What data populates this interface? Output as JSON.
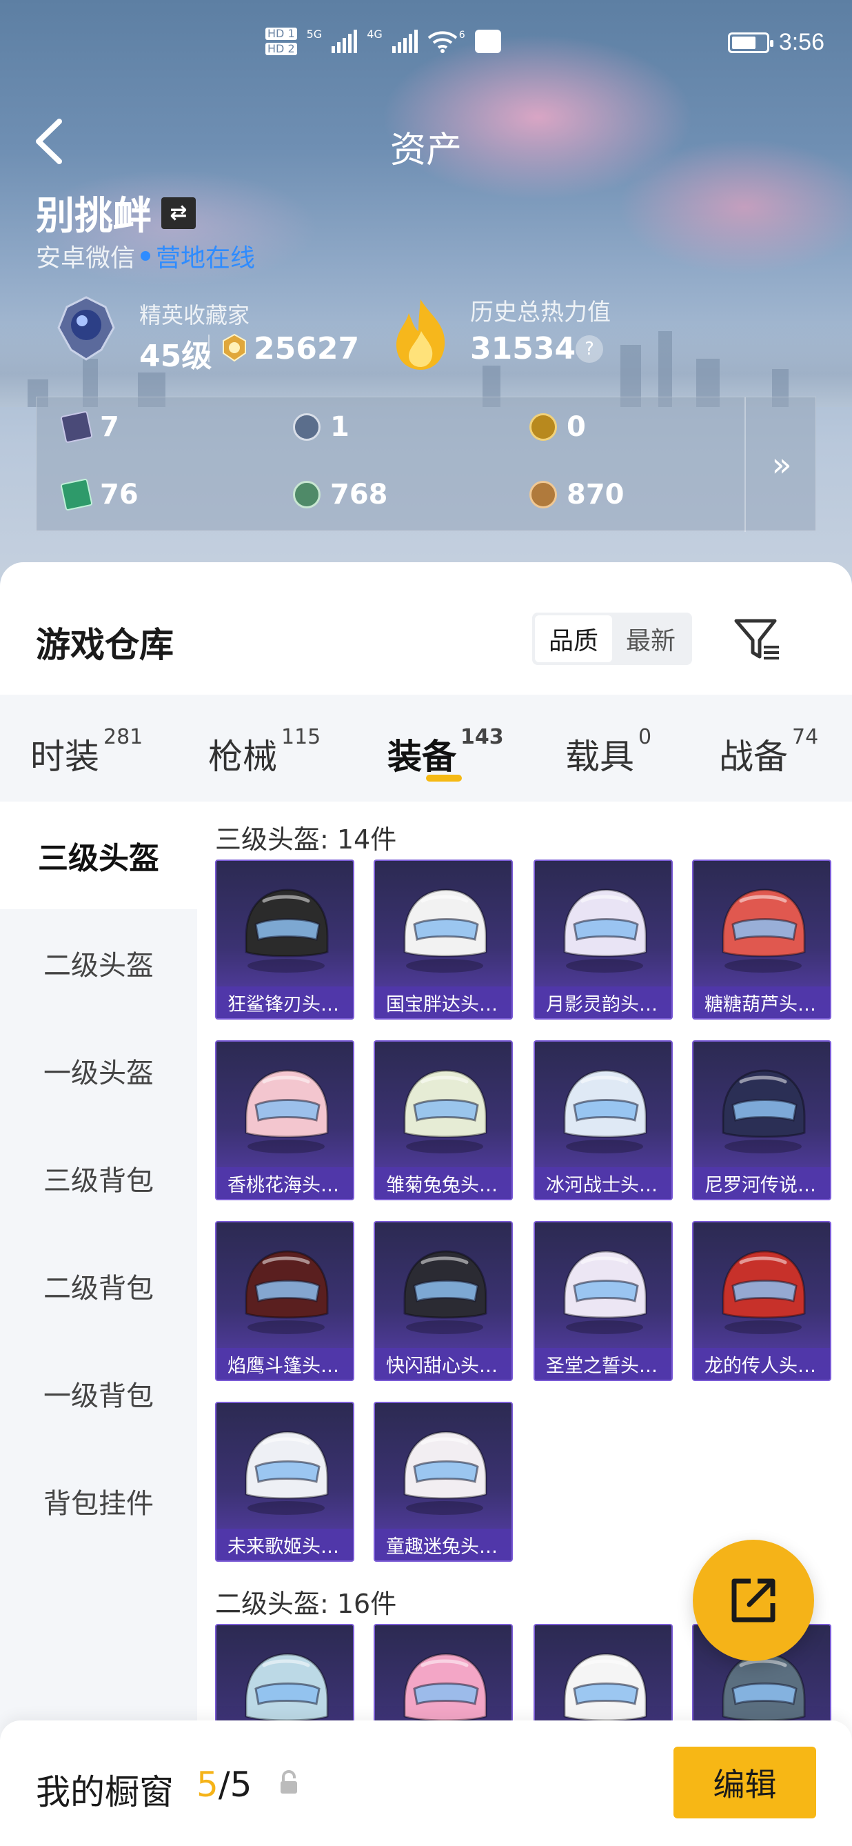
{
  "status": {
    "left_icons": [
      "HD 1",
      "HD 2",
      "5G",
      "4G",
      "6"
    ],
    "time": "3:56"
  },
  "header": {
    "title": "资产",
    "username": "别挑衅",
    "platform": "安卓微信",
    "online_status": "营地在线"
  },
  "rank": {
    "title": "精英收藏家",
    "level": "45级",
    "coins": "25627"
  },
  "heat": {
    "title": "历史总热力值",
    "value": "31534",
    "help": "?"
  },
  "currencies": [
    {
      "icon": "card-icon",
      "value": "7",
      "color": "#4a4a78"
    },
    {
      "icon": "silver-token-icon",
      "value": "1",
      "color": "#5b6e8c"
    },
    {
      "icon": "gold-badge-icon",
      "value": "0",
      "color": "#b8891e"
    },
    {
      "icon": "green-card-icon",
      "value": "76",
      "color": "#2e9a6a"
    },
    {
      "icon": "green-coin-icon",
      "value": "768",
      "color": "#4f8a68"
    },
    {
      "icon": "bronze-coin-icon",
      "value": "870",
      "color": "#b07a3c"
    }
  ],
  "warehouse": {
    "title": "游戏仓库",
    "sort_options": [
      "品质",
      "最新"
    ],
    "active_sort": "品质"
  },
  "tabs": [
    {
      "label": "时装",
      "count": "281"
    },
    {
      "label": "枪械",
      "count": "115"
    },
    {
      "label": "装备",
      "count": "143"
    },
    {
      "label": "载具",
      "count": "0"
    },
    {
      "label": "战备",
      "count": "74"
    }
  ],
  "active_tab": "装备",
  "side_nav": [
    "三级头盔",
    "二级头盔",
    "一级头盔",
    "三级背包",
    "二级背包",
    "一级背包",
    "背包挂件"
  ],
  "sections": [
    {
      "label": "三级头盔: 14件",
      "items": [
        {
          "name": "狂鲨锋刃头…",
          "color": "#2b2b2b"
        },
        {
          "name": "国宝胖达头…",
          "color": "#f2f2f2"
        },
        {
          "name": "月影灵韵头…",
          "color": "#e9e4f5"
        },
        {
          "name": "糖糖葫芦头…",
          "color": "#e0584f"
        },
        {
          "name": "香桃花海头…",
          "color": "#f3c6cf"
        },
        {
          "name": "雏菊兔兔头…",
          "color": "#e6ecd5"
        },
        {
          "name": "冰河战士头…",
          "color": "#dfe9f5"
        },
        {
          "name": "尼罗河传说…",
          "color": "#2b2f55"
        },
        {
          "name": "焰鹰斗篷头…",
          "color": "#5a1f1f"
        },
        {
          "name": "快闪甜心头…",
          "color": "#2b2b33"
        },
        {
          "name": "圣堂之誓头…",
          "color": "#ece6f4"
        },
        {
          "name": "龙的传人头…",
          "color": "#c7312a"
        },
        {
          "name": "未来歌姬头…",
          "color": "#eef0f5"
        },
        {
          "name": "童趣迷兔头…",
          "color": "#f2eef2"
        }
      ]
    },
    {
      "label": "二级头盔: 16件",
      "items": [
        {
          "name": "",
          "color": "#bcd9e6"
        },
        {
          "name": "",
          "color": "#f3a6c6"
        },
        {
          "name": "",
          "color": "#f5f5f5"
        },
        {
          "name": "",
          "color": "#5b6f80"
        }
      ]
    }
  ],
  "bottom": {
    "showcase_label": "我的橱窗",
    "showcase_current": "5",
    "showcase_total": "/5",
    "edit_label": "编辑"
  }
}
